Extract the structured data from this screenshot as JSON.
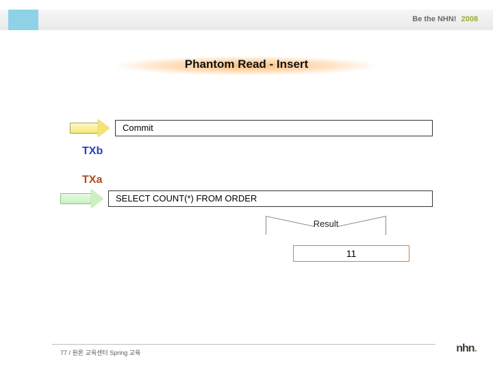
{
  "header": {
    "brand_text": "Be the NHN!",
    "brand_year": "2008"
  },
  "title": "Phantom Read - Insert",
  "tx": {
    "b_label": "TXb",
    "a_label": "TXa"
  },
  "commit": {
    "label": "Commit"
  },
  "query": {
    "sql": "SELECT COUNT(*) FROM ORDER"
  },
  "result": {
    "label": "Result",
    "value": "11"
  },
  "footer": {
    "page_text": "77 / 원론 교육센터 Spring 교육",
    "logo_text": "nhn",
    "logo_dot": "."
  }
}
